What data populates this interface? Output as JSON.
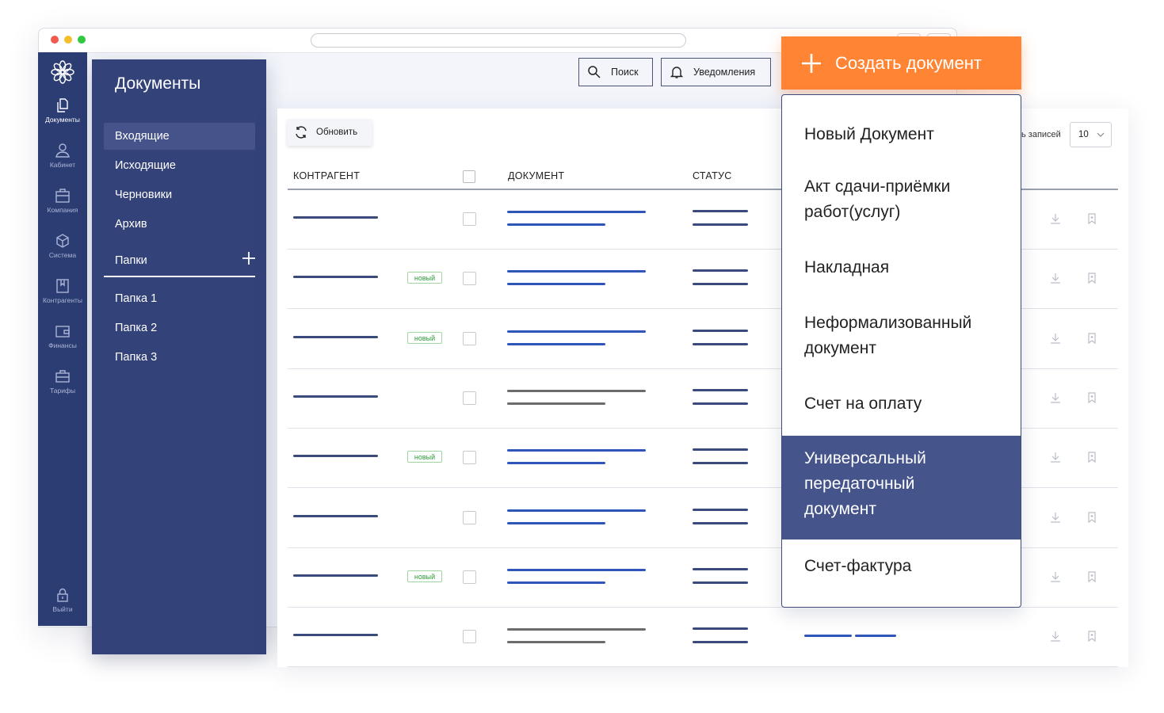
{
  "app": {
    "logo_icon": "flower-logo-icon"
  },
  "rail": {
    "items": [
      {
        "label": "Документы",
        "icon": "documents-icon",
        "active": true
      },
      {
        "label": "Кабинет",
        "icon": "user-icon"
      },
      {
        "label": "Компания",
        "icon": "building-icon"
      },
      {
        "label": "Система",
        "icon": "cube-icon"
      },
      {
        "label": "Контрагенты",
        "icon": "book-icon"
      },
      {
        "label": "Финансы",
        "icon": "wallet-icon"
      },
      {
        "label": "Тарифы",
        "icon": "briefcase-icon"
      }
    ],
    "logout": {
      "label": "Выйти",
      "icon": "lock-icon"
    }
  },
  "nav": {
    "title": "Документы",
    "items": [
      {
        "label": "Входящие",
        "active": true
      },
      {
        "label": "Исходящие"
      },
      {
        "label": "Черновики"
      },
      {
        "label": "Архив"
      }
    ],
    "folders_title": "Папки",
    "folders": [
      {
        "label": "Папка 1"
      },
      {
        "label": "Папка 2"
      },
      {
        "label": "Папка 3"
      }
    ]
  },
  "toolbar": {
    "search_label": "Поиск",
    "notifications_label": "Уведомления",
    "refresh_label": "Обновить",
    "records_label": "ь записей",
    "records_value": "10"
  },
  "table": {
    "columns": [
      "КОНТРАГЕНТ",
      "ДОКУМЕНТ",
      "СТАТУС"
    ],
    "badge_text": "новый",
    "rows": [
      {
        "badge": false,
        "doc_color": "#2f55b8"
      },
      {
        "badge": true,
        "doc_color": "#2f55b8"
      },
      {
        "badge": true,
        "doc_color": "#2f55b8"
      },
      {
        "badge": false,
        "doc_color": "#6b6b6b"
      },
      {
        "badge": true,
        "doc_color": "#2f55b8"
      },
      {
        "badge": false,
        "doc_color": "#2f55b8"
      },
      {
        "badge": true,
        "doc_color": "#2f55b8"
      },
      {
        "badge": false,
        "doc_color": "#6b6b6b"
      }
    ]
  },
  "create": {
    "label": "Создать документ",
    "accent": "#ff8534",
    "menu": [
      {
        "label": "Новый Документ"
      },
      {
        "label": "Акт сдачи-приёмки работ(услуг)"
      },
      {
        "label": "Накладная"
      },
      {
        "label": "Неформализованный документ"
      },
      {
        "label": "Счет на оплату"
      },
      {
        "label": "Универсальный передаточный документ",
        "highlighted": true
      },
      {
        "label": "Счет-фактура"
      }
    ]
  },
  "colors": {
    "rail": "#2c3d73",
    "nav": "#34427a",
    "highlight": "#45548a",
    "badge": "#2e9b3c"
  }
}
